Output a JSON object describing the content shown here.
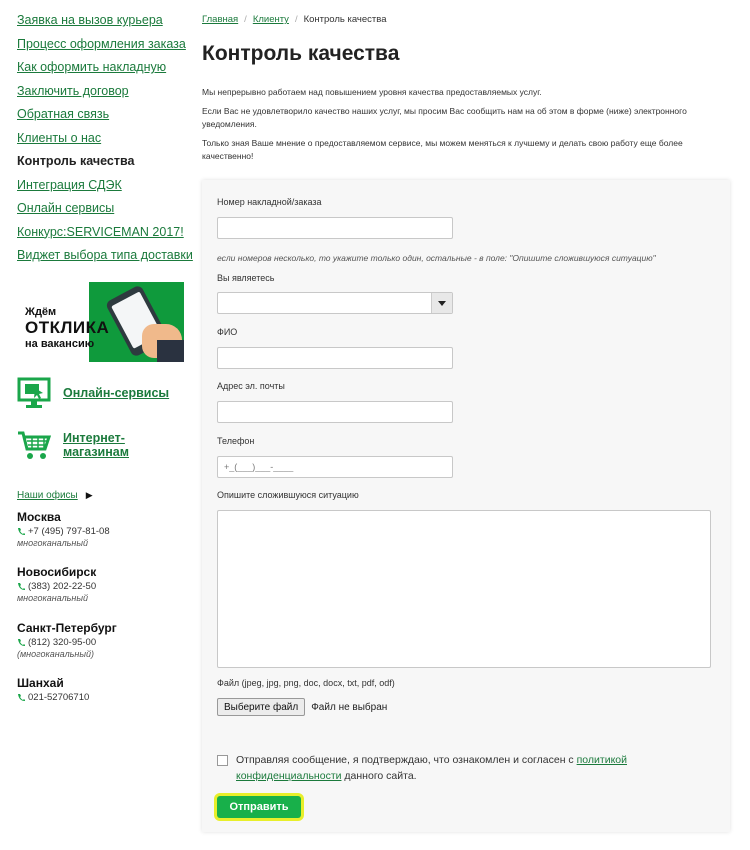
{
  "sidebar": {
    "menu": [
      {
        "label": "Заявка на вызов курьера",
        "active": false
      },
      {
        "label": "Процесс оформления заказа",
        "active": false
      },
      {
        "label": "Как оформить накладную",
        "active": false
      },
      {
        "label": "Заключить договор",
        "active": false
      },
      {
        "label": "Обратная связь",
        "active": false
      },
      {
        "label": "Клиенты о нас",
        "active": false
      },
      {
        "label": "Контроль качества",
        "active": true
      },
      {
        "label": "Интеграция СДЭК",
        "active": false
      },
      {
        "label": "Онлайн сервисы",
        "active": false
      },
      {
        "label": "Конкурс:SERVICEMAN 2017!",
        "active": false
      },
      {
        "label": "Виджет выбора типа доставки",
        "active": false
      }
    ],
    "banner": {
      "line1": "Ждём",
      "line2": "ОТКЛИКА",
      "line3": "на вакансию"
    },
    "online_services_label": "Онлайн-сервисы",
    "shops_label_1": "Интернет-",
    "shops_label_2": "магазинам",
    "offices_label": "Наши офисы",
    "cities": [
      {
        "name": "Москва",
        "phone": "+7 (495) 797-81-08",
        "note": "многоканальный"
      },
      {
        "name": "Новосибирск",
        "phone": "(383) 202-22-50",
        "note": "многоканальный"
      },
      {
        "name": "Санкт-Петербург",
        "phone": "(812) 320-95-00",
        "note": "(многоканальный)"
      },
      {
        "name": "Шанхай",
        "phone": "021-52706710",
        "note": ""
      }
    ]
  },
  "breadcrumb": {
    "home": "Главная",
    "clients": "Клиенту",
    "current": "Контроль качества",
    "separator": "/"
  },
  "page": {
    "title": "Контроль качества",
    "intro": [
      "Мы  непрерывно работаем над повышением уровня качества предоставляемых услуг.",
      "Если Вас не удовлетворило качество наших  услуг, мы просим Вас сообщить нам на об этом в форме (ниже) электронного уведомления.",
      "Только зная Ваше мнение о предоставляемом сервисе, мы можем меняться к лучшему и делать свою работу еще более качественно!"
    ]
  },
  "form": {
    "order_label": "Номер накладной/заказа",
    "order_hint": "если номеров несколько, то укажите только один, остальные - в поле: \"Опишите сложившуюся ситуацию\"",
    "role_label": "Вы являетесь",
    "role_value": "",
    "name_label": "ФИО",
    "email_label": "Адрес эл. почты",
    "phone_label": "Телефон",
    "phone_placeholder": "+_(___)___-____",
    "situation_label": "Опишите сложившуюся ситуацию",
    "file_label": "Файл (jpeg, jpg, png, doc, docx, txt, pdf, odf)",
    "file_button": "Выберите файл",
    "file_status": "Файл не выбран",
    "consent_text_before": "Отправляя сообщение, я подтверждаю, что ознакомлен и согласен с ",
    "consent_link": "политикой конфиденциальности",
    "consent_text_after": " данного сайта.",
    "submit_label": "Отправить"
  },
  "colors": {
    "brand_green": "#1b7a3c",
    "button_green": "#18b04a",
    "highlight": "#e8ef2a"
  },
  "icons": [
    "monitor-icon",
    "shopping-cart-icon",
    "phone-icon",
    "arrow-right-icon",
    "chevron-down-icon"
  ]
}
